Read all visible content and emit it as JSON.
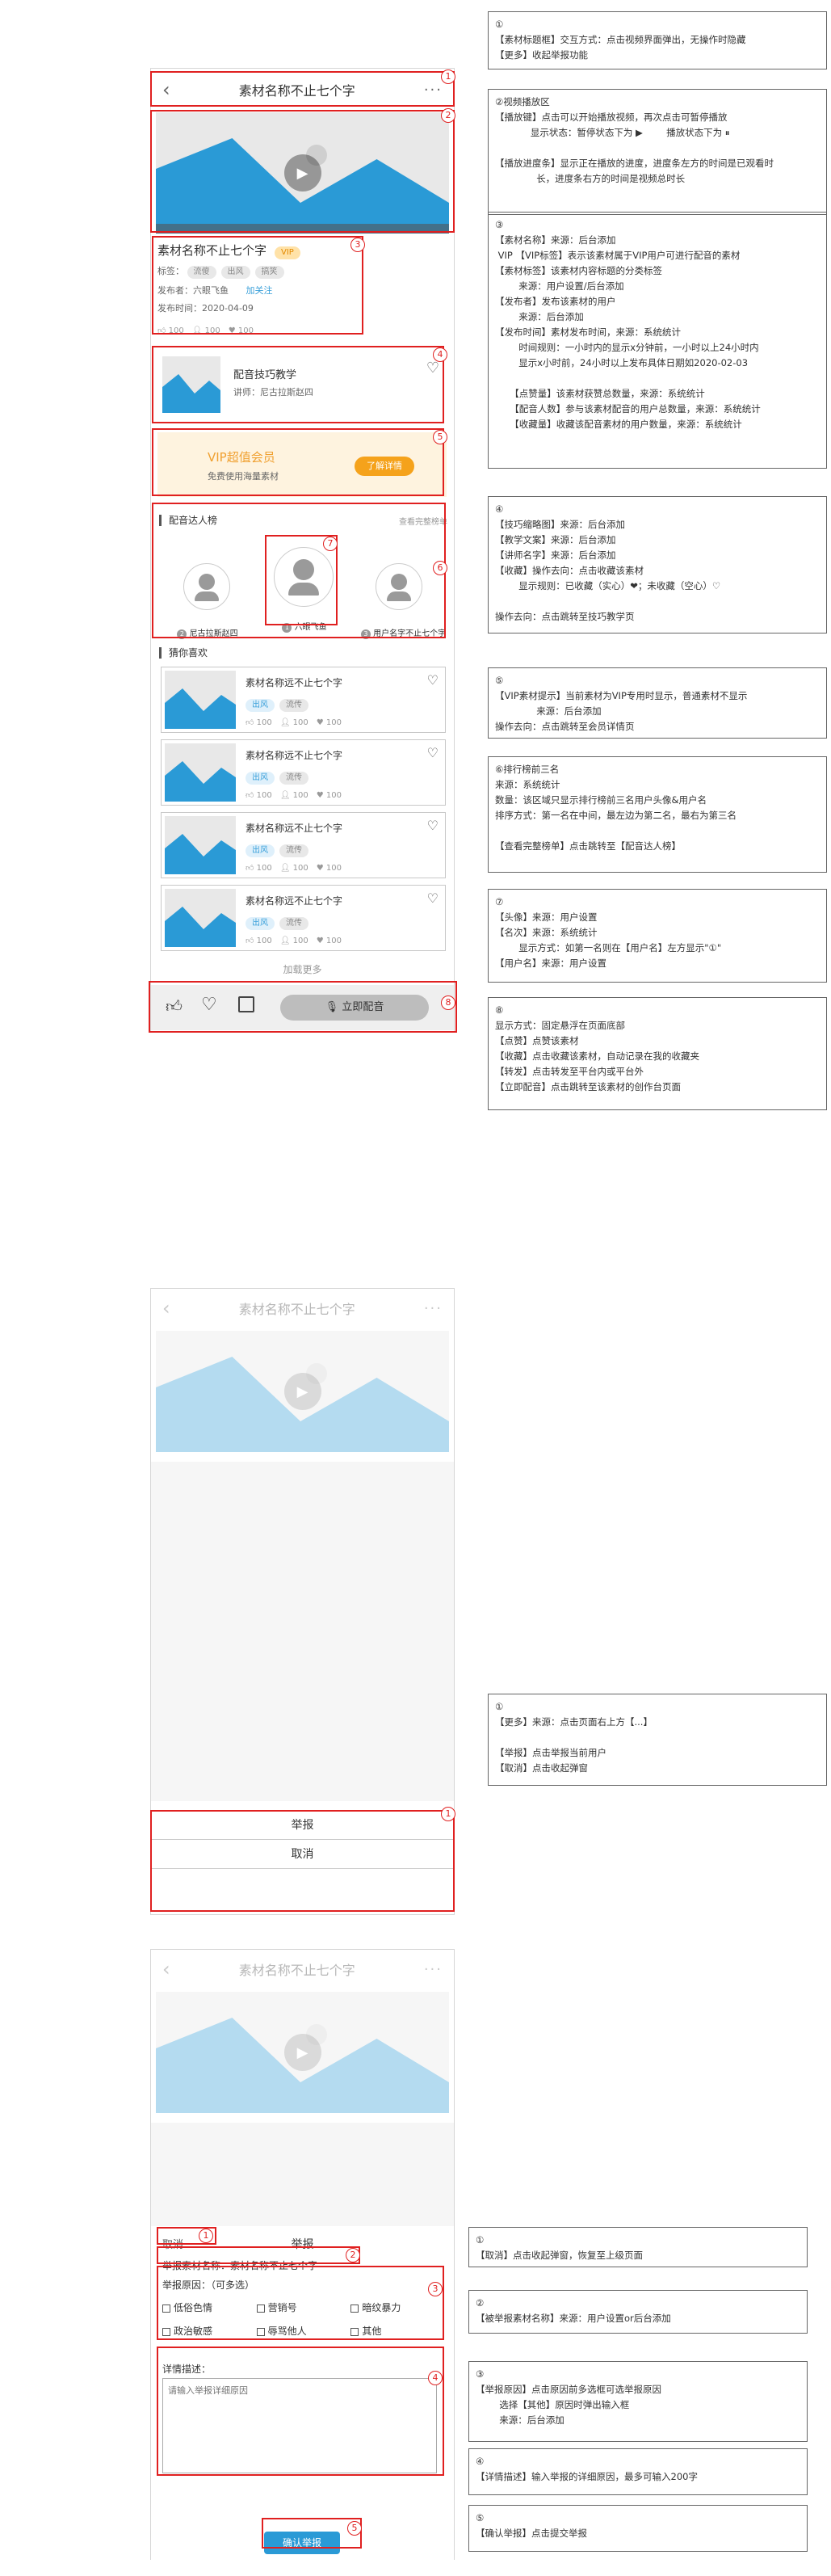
{
  "s1": {
    "nav_title": "素材名称不止七个字",
    "back_icon": "‹",
    "more_icon": "···",
    "material_title": "素材名称不止七个字",
    "vip_label": "VIP",
    "tags_label": "标签：",
    "tags": [
      "流傻",
      "出风",
      "搞笑"
    ],
    "publisher": "发布者：六眼飞鱼",
    "follow": "加关注",
    "publish_time": "发布时间：2020-04-09",
    "course_title": "配音技巧教学",
    "course_lecturer": "讲师：尼古拉斯赵四",
    "vip_promo_title": "VIP超值会员",
    "vip_promo_sub": "免费使用海量素材",
    "vip_promo_btn": "了解详情",
    "rank_title": "配音达人榜",
    "rank_more": "查看完整榜单",
    "rank": [
      {
        "num": "2",
        "name": "尼古拉斯赵四"
      },
      {
        "num": "1",
        "name": "六眼飞鱼"
      },
      {
        "num": "3",
        "name": "用户名字不止七个字"
      }
    ],
    "guess_title": "猜你喜欢",
    "guess_items": [
      {
        "title": "素材名称远不止七个字",
        "tags": [
          "出风",
          "流传"
        ],
        "likes": "100",
        "users": "100",
        "favs": "100"
      },
      {
        "title": "素材名称远不止七个字",
        "tags": [
          "出风",
          "流传"
        ],
        "likes": "100",
        "users": "100",
        "favs": "100"
      },
      {
        "title": "素材名称远不止七个字",
        "tags": [
          "出风",
          "流传"
        ],
        "likes": "100",
        "users": "100",
        "favs": "100"
      },
      {
        "title": "素材名称远不止七个字",
        "tags": [
          "出风",
          "流传"
        ],
        "likes": "100",
        "users": "100",
        "favs": "100"
      }
    ],
    "load_more": "加载更多",
    "dub_btn": "立即配音",
    "stat_likes": "100",
    "stat_users": "100",
    "stat_favs": "100"
  },
  "ann1": [
    "①\n【素材标题框】交互方式：点击视频界面弹出，无操作时隐藏\n【更多】收起举报功能",
    "②视频播放区\n【播放键】点击可以开始播放视频，再次点击可暂停播放\n            显示状态：暂停状态下为 ▶        播放状态下为 ⏸\n\n【播放进度条】显示正在播放的进度，进度条左方的时间是已观看时\n              长，进度条右方的时间是视频总时长",
    "③\n【素材名称】来源：后台添加\n VIP 【VIP标签】表示该素材属于VIP用户可进行配音的素材\n【素材标签】该素材内容标题的分类标签\n        来源：用户设置/后台添加\n【发布者】发布该素材的用户\n        来源：后台添加\n【发布时间】素材发布时间，来源：系统统计\n        时间规则：一小时内的显示x分钟前，一小时以上24小时内\n        显示x小时前，24小时以上发布具体日期如2020-02-03\n\n     【点赞量】该素材获赞总数量，来源：系统统计\n     【配音人数】参与该素材配音的用户总数量，来源：系统统计\n     【收藏量】收藏该配音素材的用户数量，来源：系统统计",
    "④\n【技巧缩略图】来源：后台添加\n【教学文案】来源：后台添加\n【讲师名字】来源：后台添加\n【收藏】操作去向：点击收藏该素材\n        显示规则：已收藏（实心）❤；未收藏（空心）♡\n\n操作去向：点击跳转至技巧教学页",
    "⑤\n【VIP素材提示】当前素材为VIP专用时显示，普通素材不显示\n              来源：后台添加\n操作去向：点击跳转至会员详情页",
    "⑥排行榜前三名\n来源：系统统计\n数量：该区域只显示排行榜前三名用户头像&用户名\n排序方式：第一名在中间，最左边为第二名，最右为第三名\n\n【查看完整榜单】点击跳转至【配音达人榜】",
    "⑦\n【头像】来源：用户设置\n【名次】来源：系统统计\n        显示方式：如第一名则在【用户名】左方显示\"①\"\n【用户名】来源：用户设置",
    "⑧\n显示方式：固定悬浮在页面底部\n【点赞】点赞该素材\n【收藏】点击收藏该素材，自动记录在我的收藏夹\n【转发】点击转发至平台内或平台外\n【立即配音】点击跳转至该素材的创作台页面"
  ],
  "s2": {
    "nav_title": "素材名称不止七个字",
    "report": "举报",
    "cancel": "取消"
  },
  "ann2": "①\n【更多】来源：点击页面右上方【...】\n\n【举报】点击举报当前用户\n【取消】点击收起弹窗",
  "s3": {
    "nav_title": "素材名称不止七个字",
    "cancel": "取消",
    "title": "举报",
    "material_name": "举报素材名称：素材名称不止七个字",
    "reason_label": "举报原因：（可多选）",
    "reasons": [
      "低俗色情",
      "营销号",
      "暗纹暴力",
      "政治敏感",
      "辱骂他人",
      "其他"
    ],
    "detail_label": "详情描述：",
    "detail_placeholder": "请输入举报详细原因",
    "confirm": "确认举报"
  },
  "ann3": [
    "①\n【取消】点击收起弹窗，恢复至上级页面",
    "②\n【被举报素材名称】来源：用户设置or后台添加",
    "③\n【举报原因】点击原因前多选框可选举报原因\n        选择【其他】原因时弹出输入框\n        来源：后台添加",
    "④\n【详情描述】输入举报的详细原因，最多可输入200字",
    "⑤\n【确认举报】点击提交举报"
  ]
}
